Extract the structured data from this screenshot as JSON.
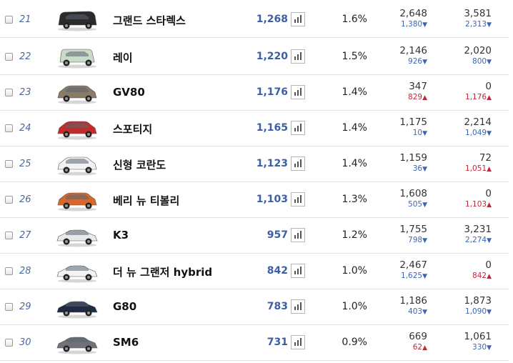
{
  "rows": [
    {
      "rank": "21",
      "name": "그랜드 스타렉스",
      "sales": "1,268",
      "share": "1.6%",
      "prev": "2,648",
      "prev_diff": "1,380",
      "prev_dir": "down",
      "last": "3,581",
      "last_diff": "2,313",
      "last_dir": "down",
      "car": {
        "color": "#2b2b2b",
        "style": "van"
      }
    },
    {
      "rank": "22",
      "name": "레이",
      "sales": "1,220",
      "share": "1.5%",
      "prev": "2,146",
      "prev_diff": "926",
      "prev_dir": "down",
      "last": "2,020",
      "last_diff": "800",
      "last_dir": "down",
      "car": {
        "color": "#c9dcc8",
        "style": "box"
      }
    },
    {
      "rank": "23",
      "name": "GV80",
      "sales": "1,176",
      "share": "1.4%",
      "prev": "347",
      "prev_diff": "829",
      "prev_dir": "up",
      "last": "0",
      "last_diff": "1,176",
      "last_dir": "up",
      "car": {
        "color": "#8a7a68",
        "style": "suv"
      }
    },
    {
      "rank": "24",
      "name": "스포티지",
      "sales": "1,165",
      "share": "1.4%",
      "prev": "1,175",
      "prev_diff": "10",
      "prev_dir": "down",
      "last": "2,214",
      "last_diff": "1,049",
      "last_dir": "down",
      "car": {
        "color": "#c42a2a",
        "style": "suv"
      }
    },
    {
      "rank": "25",
      "name": "신형 코란도",
      "sales": "1,123",
      "share": "1.4%",
      "prev": "1,159",
      "prev_diff": "36",
      "prev_dir": "down",
      "last": "72",
      "last_diff": "1,051",
      "last_dir": "up",
      "car": {
        "color": "#f2f2f2",
        "style": "suv"
      }
    },
    {
      "rank": "26",
      "name": "베리 뉴 티볼리",
      "sales": "1,103",
      "share": "1.3%",
      "prev": "1,608",
      "prev_diff": "505",
      "prev_dir": "down",
      "last": "0",
      "last_diff": "1,103",
      "last_dir": "up",
      "car": {
        "color": "#d9662a",
        "style": "suv"
      }
    },
    {
      "rank": "27",
      "name": "K3",
      "sales": "957",
      "share": "1.2%",
      "prev": "1,755",
      "prev_diff": "798",
      "prev_dir": "down",
      "last": "3,231",
      "last_diff": "2,274",
      "last_dir": "down",
      "car": {
        "color": "#e9e9ec",
        "style": "sedan"
      }
    },
    {
      "rank": "28",
      "name": "더 뉴 그랜저 hybrid",
      "sales": "842",
      "share": "1.0%",
      "prev": "2,467",
      "prev_diff": "1,625",
      "prev_dir": "down",
      "last": "0",
      "last_diff": "842",
      "last_dir": "up",
      "car": {
        "color": "#f3f3f5",
        "style": "sedan"
      }
    },
    {
      "rank": "29",
      "name": "G80",
      "sales": "783",
      "share": "1.0%",
      "prev": "1,186",
      "prev_diff": "403",
      "prev_dir": "down",
      "last": "1,873",
      "last_diff": "1,090",
      "last_dir": "down",
      "car": {
        "color": "#1f2b45",
        "style": "sedan"
      }
    },
    {
      "rank": "30",
      "name": "SM6",
      "sales": "731",
      "share": "0.9%",
      "prev": "669",
      "prev_diff": "62",
      "prev_dir": "up",
      "last": "1,061",
      "last_diff": "330",
      "last_dir": "down",
      "car": {
        "color": "#6f7378",
        "style": "sedan"
      }
    }
  ],
  "arrows": {
    "up": "▲",
    "down": "▼"
  }
}
